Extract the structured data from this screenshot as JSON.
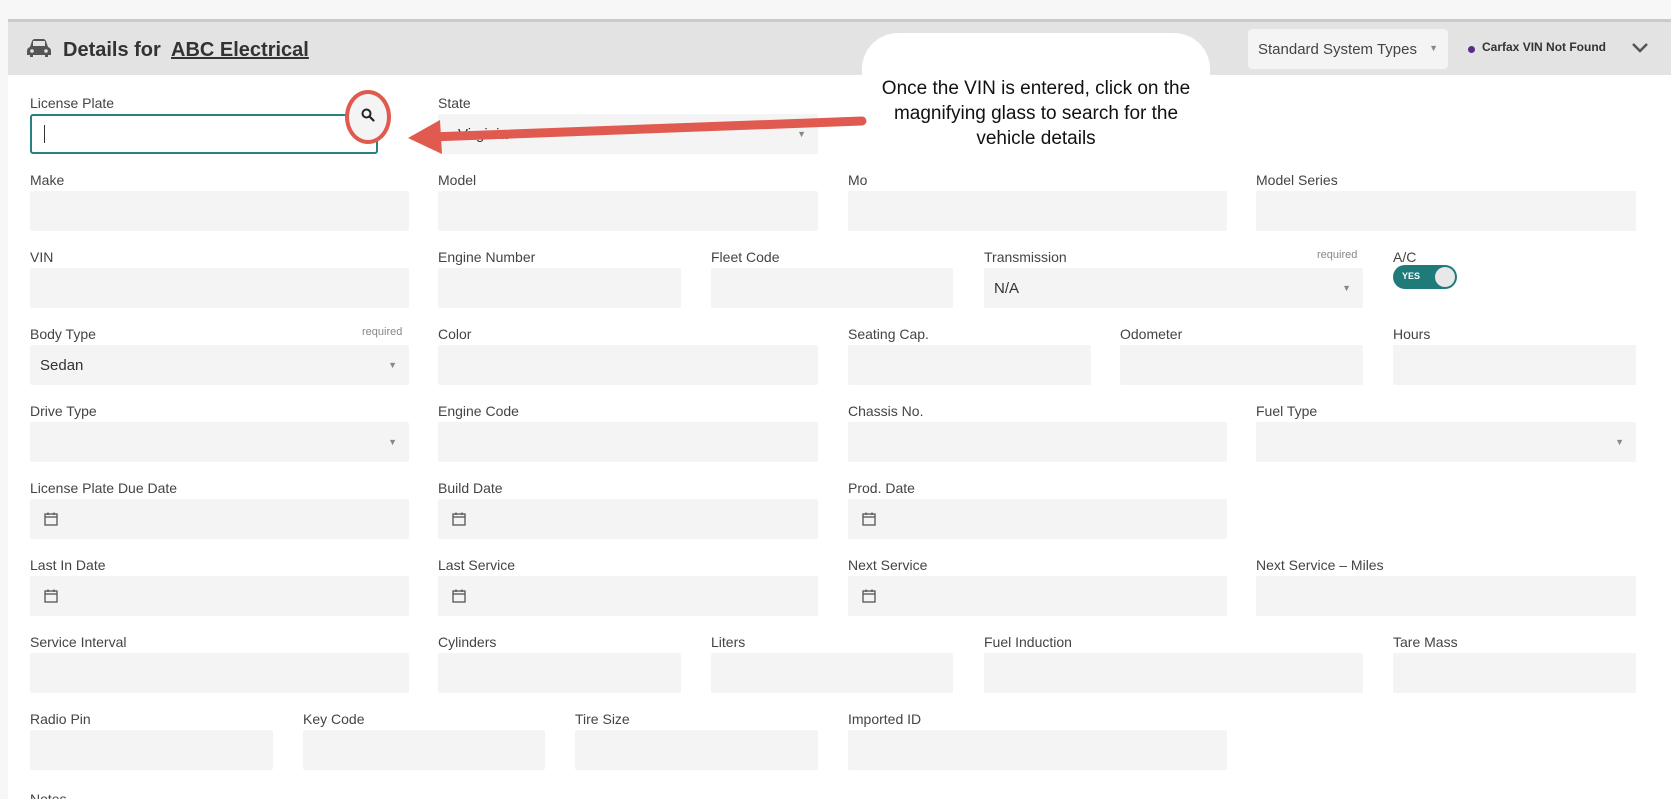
{
  "header": {
    "title_prefix": "Details for",
    "title_link": "ABC Electrical",
    "system_type_select": "Standard System Types",
    "carfax_status": "Carfax VIN Not Found"
  },
  "callout": {
    "text": "Once the VIN is entered, click on the magnifying glass to search for the vehicle details"
  },
  "required_label": "required",
  "toggle": {
    "label": "YES",
    "on": true
  },
  "fields": {
    "license_plate": {
      "label": "License Plate",
      "value": ""
    },
    "state": {
      "label": "State",
      "value": "Virginia"
    },
    "make": {
      "label": "Make",
      "value": ""
    },
    "model": {
      "label": "Model",
      "value": ""
    },
    "model_partial": {
      "label": "Mo",
      "value": ""
    },
    "model_series": {
      "label": "Model Series",
      "value": ""
    },
    "vin": {
      "label": "VIN",
      "value": ""
    },
    "engine_number": {
      "label": "Engine Number",
      "value": ""
    },
    "fleet_code": {
      "label": "Fleet Code",
      "value": ""
    },
    "transmission": {
      "label": "Transmission",
      "value": "N/A"
    },
    "ac": {
      "label": "A/C"
    },
    "body_type": {
      "label": "Body Type",
      "value": "Sedan"
    },
    "color": {
      "label": "Color",
      "value": ""
    },
    "seating_cap": {
      "label": "Seating Cap.",
      "value": ""
    },
    "odometer": {
      "label": "Odometer",
      "value": ""
    },
    "hours": {
      "label": "Hours",
      "value": ""
    },
    "drive_type": {
      "label": "Drive Type",
      "value": ""
    },
    "engine_code": {
      "label": "Engine Code",
      "value": ""
    },
    "chassis_no": {
      "label": "Chassis No.",
      "value": ""
    },
    "fuel_type": {
      "label": "Fuel Type",
      "value": ""
    },
    "lp_due_date": {
      "label": "License Plate Due Date",
      "value": ""
    },
    "build_date": {
      "label": "Build Date",
      "value": ""
    },
    "prod_date": {
      "label": "Prod. Date",
      "value": ""
    },
    "last_in_date": {
      "label": "Last In Date",
      "value": ""
    },
    "last_service": {
      "label": "Last Service",
      "value": ""
    },
    "next_service": {
      "label": "Next Service",
      "value": ""
    },
    "next_service_miles": {
      "label": "Next Service – Miles",
      "value": ""
    },
    "service_interval": {
      "label": "Service Interval",
      "value": ""
    },
    "cylinders": {
      "label": "Cylinders",
      "value": ""
    },
    "liters": {
      "label": "Liters",
      "value": ""
    },
    "fuel_induction": {
      "label": "Fuel Induction",
      "value": ""
    },
    "tare_mass": {
      "label": "Tare Mass",
      "value": ""
    },
    "radio_pin": {
      "label": "Radio Pin",
      "value": ""
    },
    "key_code": {
      "label": "Key Code",
      "value": ""
    },
    "tire_size": {
      "label": "Tire Size",
      "value": ""
    },
    "imported_id": {
      "label": "Imported ID",
      "value": ""
    },
    "notes": {
      "label": "Notes"
    }
  },
  "colors": {
    "accent_teal": "#1f7a7a",
    "annotation_red": "#e05a4f",
    "header_bg": "#e3e3e3",
    "input_bg": "#f4f4f4"
  }
}
